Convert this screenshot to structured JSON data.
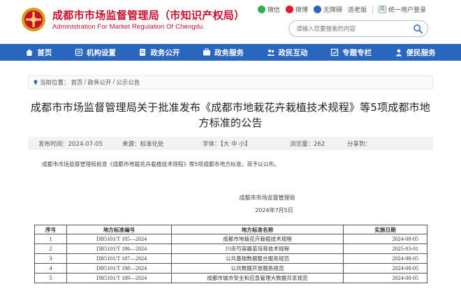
{
  "header": {
    "title_cn": "成都市市场监督管理局（市知识产权局）",
    "title_en": "Administration For Market Regulation Of Chengdu",
    "links": {
      "wechat": "微信",
      "weibo": "微博",
      "accessibility": "无障碍",
      "elderly": "适老版",
      "login_glyph": "简",
      "login": "统一用户登录"
    },
    "search": {
      "placeholder": "请输入您要搜索的内容"
    }
  },
  "nav": {
    "items": [
      {
        "label": "首页",
        "icon": "home-icon"
      },
      {
        "label": "机构设置",
        "icon": "org-icon"
      },
      {
        "label": "政务公开",
        "icon": "open-icon"
      },
      {
        "label": "政务服务",
        "icon": "service-icon"
      },
      {
        "label": "政民互动",
        "icon": "interaction-icon"
      },
      {
        "label": "专题专栏",
        "icon": "topic-icon"
      },
      {
        "label": "便民服务",
        "icon": "convenience-icon"
      }
    ]
  },
  "breadcrumb": {
    "prefix": "当前位置：",
    "items": [
      "首页",
      "政务公开",
      "公示公告"
    ],
    "separator": "/"
  },
  "article": {
    "title": "成都市市场监督管理局关于批准发布《成都市地栽花卉栽植技术规程》等5项成都市地方标准的公告",
    "meta": {
      "date": "发布时间：2024-07-05",
      "source": "来源：标准化处",
      "font": "字体：【大 中 小】",
      "views": "浏览量：262",
      "share": "分享到："
    },
    "paragraph": "成都市市场监督管理局批准《成都市地栽花卉栽植技术规程》等5项成都市地方标准，现予以公布。",
    "org": "成都市市场监督管理局",
    "date_sign": "2024年7月5日"
  },
  "table": {
    "headers": [
      "序号",
      "地方标准编号",
      "地方标准名称",
      "实施日期"
    ],
    "rows": [
      [
        "1",
        "DB5101/T 185—2024",
        "成都市地栽花卉栽植技术规程",
        "2024-08-05"
      ],
      [
        "2",
        "DB5101/T 186—2024",
        "川赤芍容器苗培育技术规程",
        "2025-03-01"
      ],
      [
        "3",
        "DB5101/T 187—2024",
        "公共基础数据整合服务规范",
        "2024-08-05"
      ],
      [
        "4",
        "DB5101/T 188—2024",
        "公共数据开放服务规范",
        "2024-08-05"
      ],
      [
        "5",
        "DB5101/T 189—2024",
        "成都市城市安全和应急管理大数据共享规范",
        "2024-08-05"
      ]
    ]
  },
  "colors": {
    "brand_red": "#c8102e",
    "nav_blue": "#2a66bd"
  }
}
